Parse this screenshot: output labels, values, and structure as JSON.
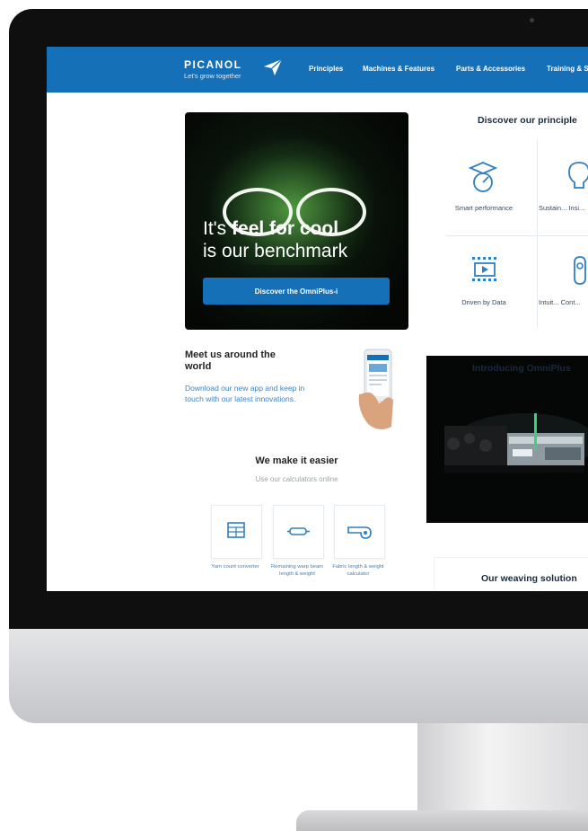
{
  "brand": {
    "name": "PICANOL",
    "tagline": "Let's grow together"
  },
  "nav": {
    "items": [
      "Principles",
      "Machines & Features",
      "Parts & Accessories",
      "Training & S"
    ]
  },
  "hero": {
    "line1_pre": "It's ",
    "line1_bold": "feel for cool",
    "line2": "is our benchmark",
    "button": "Discover the OmniPlus-i"
  },
  "meet": {
    "title": "Meet us around the world",
    "text": "Download our new app and keep in touch with our latest innovations."
  },
  "easier": {
    "title": "We make it easier",
    "subtitle": "Use our calculators online",
    "calculators": [
      {
        "label": "Yarn count converter",
        "icon": "yarn-count-icon"
      },
      {
        "label": "Remaining warp beam length & weight",
        "icon": "warp-beam-icon"
      },
      {
        "label": "Fabric length & weight calculator",
        "icon": "fabric-calculator-icon"
      }
    ]
  },
  "principles": {
    "title": "Discover our principle",
    "items": [
      {
        "label": "Smart performance",
        "icon": "smart-performance-icon"
      },
      {
        "label": "Sustain... Insi...",
        "icon": "sustainable-insight-icon"
      },
      {
        "label": "Driven by Data",
        "icon": "driven-by-data-icon"
      },
      {
        "label": "Intuit... Cont...",
        "icon": "intuitive-control-icon"
      }
    ]
  },
  "omni": {
    "title": "Introducing OmniPlus"
  },
  "weaving": {
    "title": "Our weaving solution"
  },
  "colors": {
    "brand_blue": "#1670b8",
    "link_blue": "#3f82c2",
    "bezel": "#0f0f10"
  }
}
